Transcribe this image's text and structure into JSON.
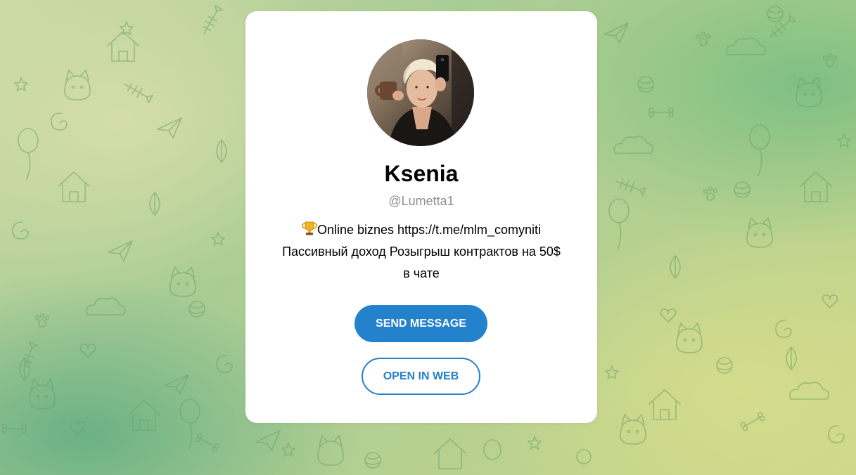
{
  "profile": {
    "name": "Ksenia",
    "username": "@Lumetta1",
    "bio_line1": "Online biznes https://t.me/mlm_comyniti",
    "bio_line2": "Пассивный доход Розыгрыш контрактов на 50$",
    "bio_line3": "в чате",
    "bio_emoji": "trophy-icon"
  },
  "actions": {
    "send_message_label": "SEND MESSAGE",
    "open_in_web_label": "OPEN IN WEB"
  },
  "colors": {
    "accent": "#2481cc",
    "card_bg": "#ffffff",
    "username": "#8f8f8f"
  }
}
